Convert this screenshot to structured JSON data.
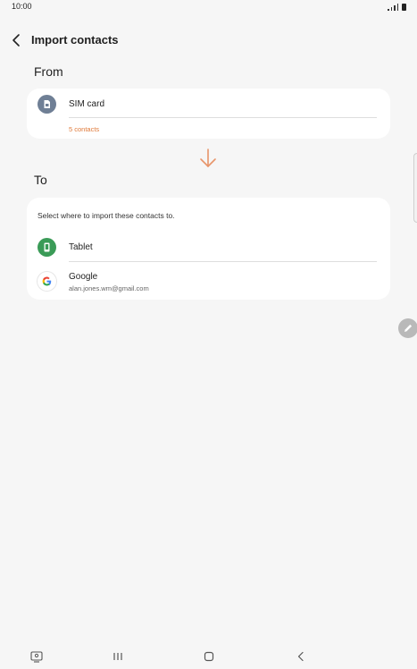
{
  "status_bar": {
    "time": "10:00"
  },
  "header": {
    "title": "Import contacts",
    "back_icon": "chevron-left-icon"
  },
  "from_section": {
    "label": "From",
    "source": {
      "name": "SIM card",
      "count": "5 contacts",
      "icon": "sim-card-icon"
    }
  },
  "to_section": {
    "label": "To",
    "instruction": "Select where to import these contacts to.",
    "destinations": [
      {
        "name": "Tablet",
        "icon": "tablet-icon"
      },
      {
        "name": "Google",
        "account": "alan.jones.wm@gmail.com",
        "icon": "google-icon"
      }
    ]
  },
  "colors": {
    "accent": "#e07b3b",
    "tablet_green": "#3a9b57",
    "sim_gray": "#6f7f95"
  }
}
